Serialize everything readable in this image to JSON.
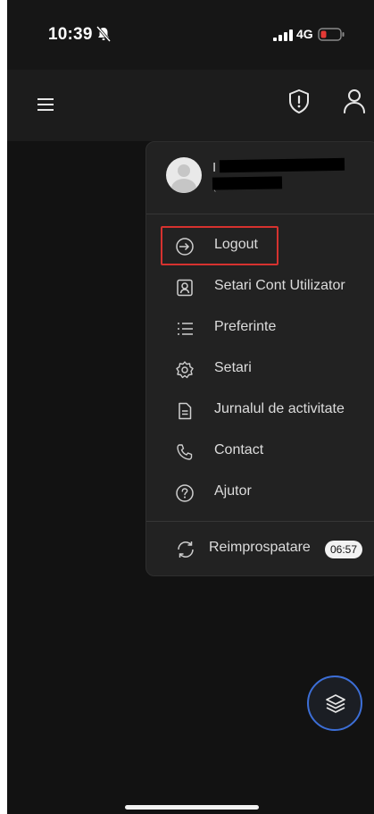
{
  "status_bar": {
    "time": "10:39",
    "network": "4G",
    "battery_color": "#e53935"
  },
  "app_bar": {
    "menu_icon": "hamburger-icon",
    "shield_icon": "shield-alert-icon",
    "user_icon": "user-icon"
  },
  "profile": {
    "name": "I",
    "id": "(",
    "avatar_icon": "avatar-icon"
  },
  "menu": {
    "items": [
      {
        "label": "Logout",
        "icon": "logout-icon"
      },
      {
        "label": "Setari Cont Utilizator",
        "icon": "account-icon"
      },
      {
        "label": "Preferinte",
        "icon": "list-icon"
      },
      {
        "label": "Setari",
        "icon": "gear-icon"
      },
      {
        "label": "Jurnalul de activitate",
        "icon": "document-icon"
      },
      {
        "label": "Contact",
        "icon": "phone-icon"
      },
      {
        "label": "Ajutor",
        "icon": "help-icon"
      }
    ],
    "highlighted_item": "Logout",
    "highlight_color": "#d6322f"
  },
  "refresh": {
    "label": "Reimprospatare",
    "timer": "06:57",
    "icon": "refresh-icon"
  },
  "fab": {
    "icon": "layers-icon",
    "accent": "#3c6ed6"
  }
}
